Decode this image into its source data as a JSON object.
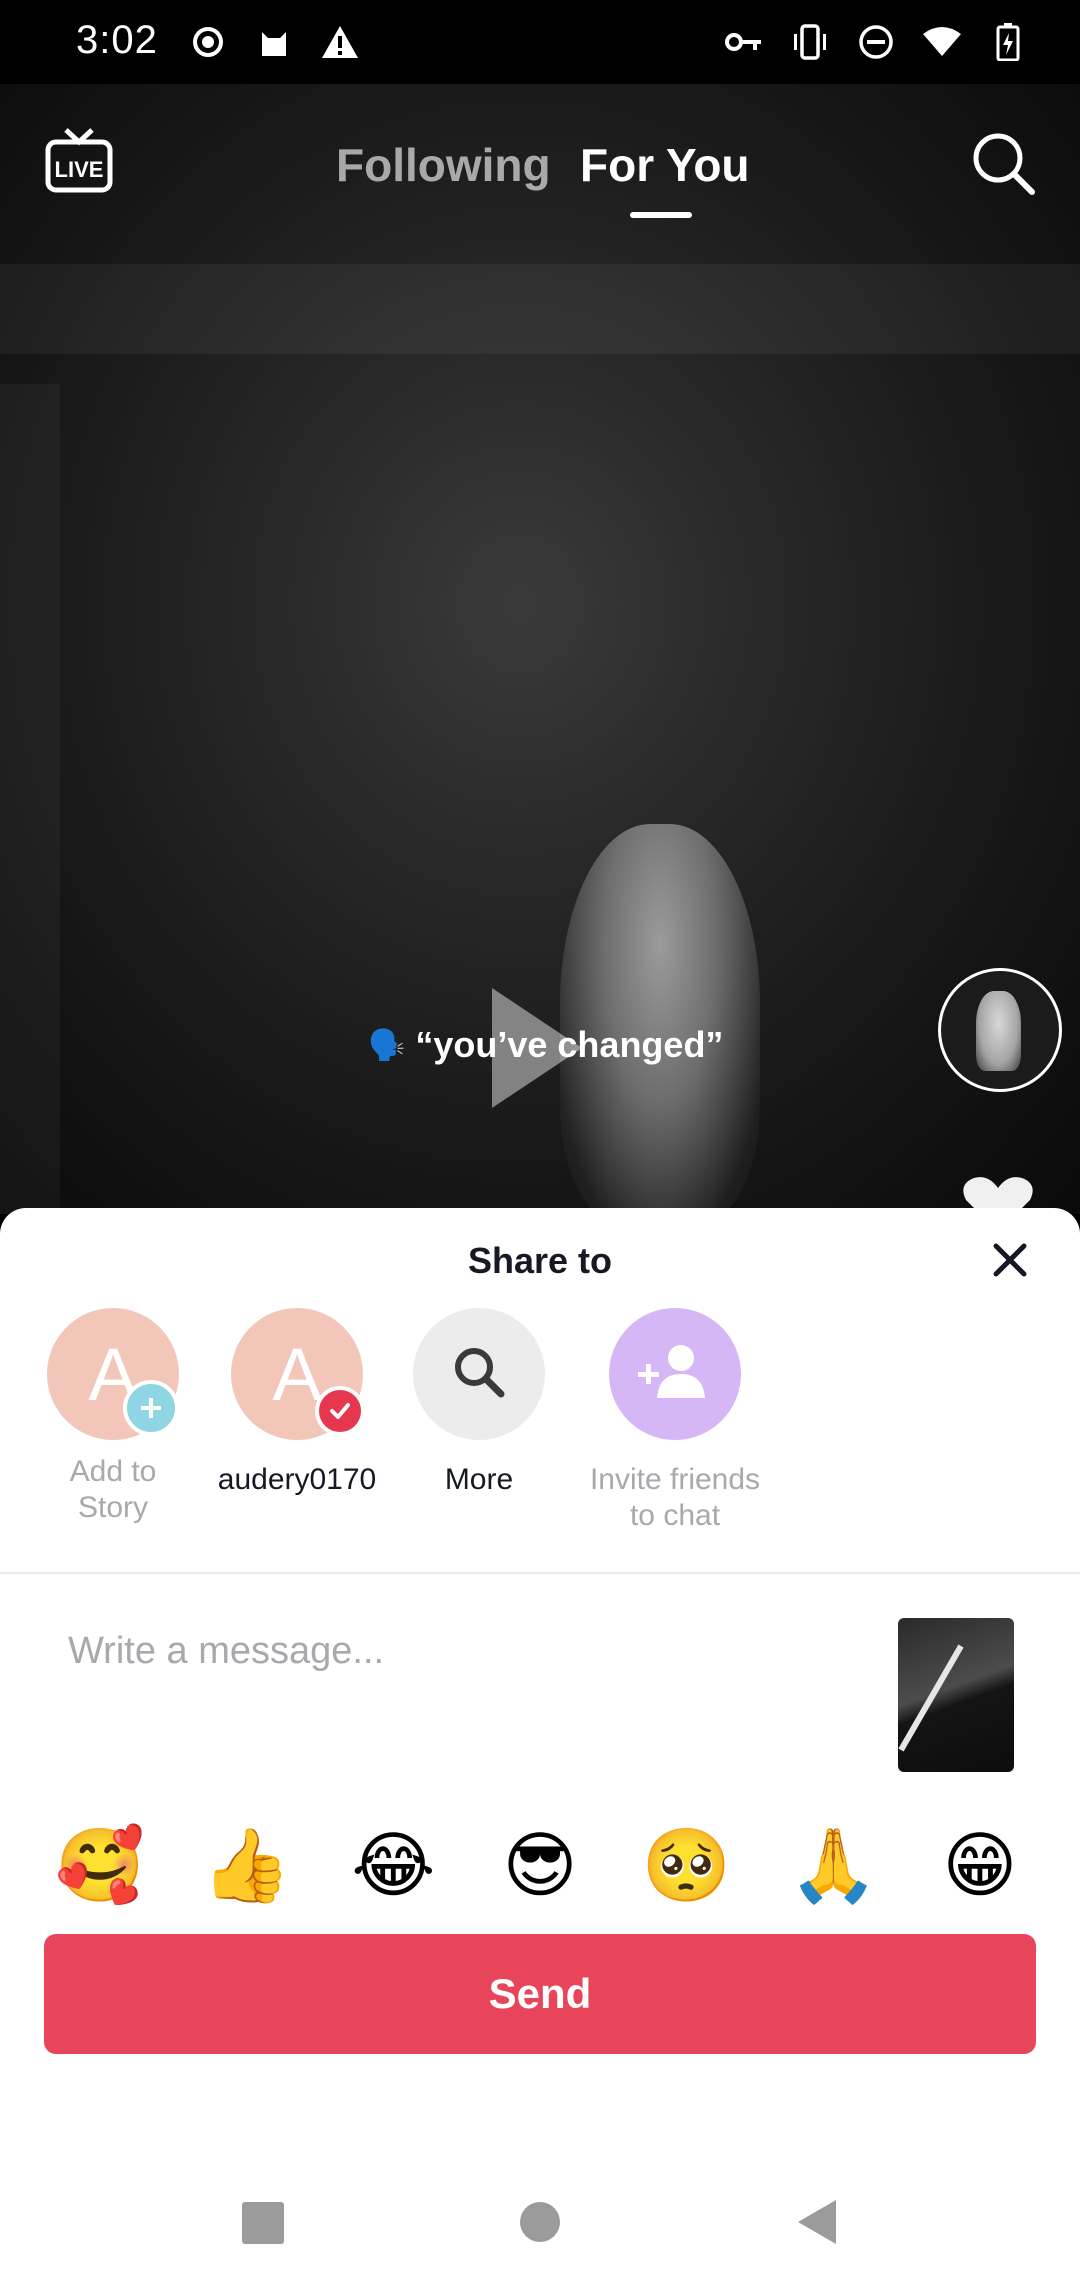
{
  "status_bar": {
    "time": "3:02",
    "left_icons": [
      "record-icon",
      "cat-icon",
      "warning-icon"
    ],
    "right_icons": [
      "key-icon",
      "vibrate-icon",
      "dnd-icon",
      "wifi-icon",
      "battery-icon"
    ]
  },
  "top_nav": {
    "live_icon": "live-icon",
    "tabs": [
      {
        "label": "Following",
        "active": false
      },
      {
        "label": "For You",
        "active": true
      }
    ],
    "search_icon": "search-icon"
  },
  "video": {
    "caption": "“you’ve changed”",
    "caption_emoji": "🗣️"
  },
  "share_sheet": {
    "title": "Share to",
    "targets": [
      {
        "label": "Add to\nStory",
        "letter": "A",
        "badge": "add"
      },
      {
        "label": "audery0170",
        "letter": "A",
        "badge": "check"
      },
      {
        "label": "More",
        "icon": "search-icon"
      },
      {
        "label": "Invite friends\nto chat",
        "icon": "add-person-icon"
      }
    ],
    "message_placeholder": "Write a message...",
    "emojis": [
      "🥰",
      "👍",
      "😂",
      "😎",
      "🥺",
      "🙏",
      "😁"
    ],
    "send_label": "Send"
  },
  "colors": {
    "send_button": "#e8445a",
    "badge_check": "#e6374f",
    "badge_add": "#8fd5e3",
    "invite_circle": "#d5b7f5",
    "avatar_circle": "#f2c6b8",
    "more_circle": "#ececec"
  }
}
